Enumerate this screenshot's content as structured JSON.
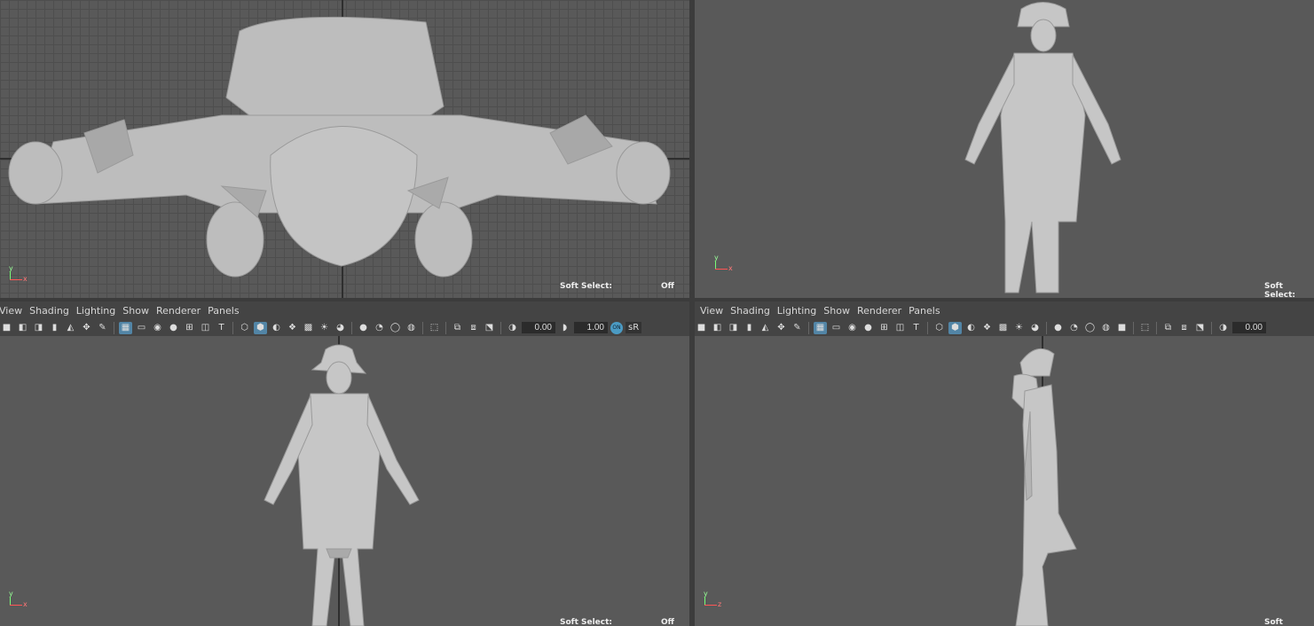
{
  "menus": {
    "left": [
      "View",
      "Shading",
      "Lighting",
      "Show",
      "Renderer",
      "Panels"
    ],
    "right": [
      "View",
      "Shading",
      "Lighting",
      "Show",
      "Renderer",
      "Panels"
    ]
  },
  "toolbar": {
    "exposure_value_left": "0.00",
    "gamma_value_left": "1.00",
    "color_mgmt_label": "ON",
    "color_space_label": "sR",
    "exposure_value_right": "0.00"
  },
  "viewports": {
    "top": {
      "soft_select_label": "Soft Select:",
      "soft_select_value": "Off"
    },
    "persp": {
      "soft_select_label": "Soft Select:"
    },
    "front": {
      "soft_select_label": "Soft Select:",
      "soft_select_value": "Off"
    },
    "side": {
      "soft_select_label": "Soft Select:"
    }
  },
  "axis_labels": {
    "x": "x",
    "y": "y",
    "z": "z"
  },
  "colors": {
    "viewport_bg": "#595959",
    "panel_bg": "#444444",
    "active_button": "#5285a6",
    "model": "#c9c9c9"
  },
  "icons": [
    "camera-icon",
    "camera-lock-icon",
    "camera-attr-icon",
    "bookmark-icon",
    "image-plane-icon",
    "2d-pan-icon",
    "grid-icon",
    "film-gate-icon",
    "resolution-gate-icon",
    "gate-mask-icon",
    "field-chart-icon",
    "safe-action-icon",
    "safe-title-icon",
    "wireframe-icon",
    "smooth-shade-icon",
    "default-material-icon",
    "textured-icon",
    "lighting-icon",
    "shadows-icon",
    "ambient-occlusion-icon",
    "motion-blur-icon",
    "anti-alias-icon",
    "depth-of-field-icon",
    "isolate-select-icon",
    "xray-icon",
    "xray-joints-icon",
    "xray-components-icon",
    "exposure-icon",
    "gamma-icon"
  ]
}
